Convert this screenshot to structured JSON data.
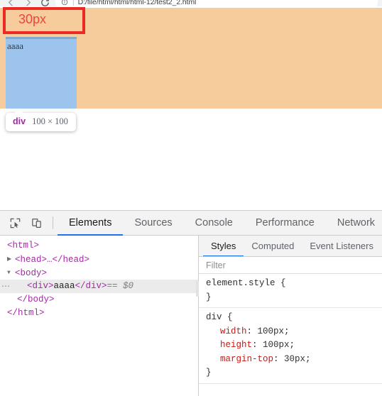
{
  "browser": {
    "back_icon": "arrow-left-icon",
    "forward_icon": "arrow-right-icon",
    "reload_icon": "reload-icon",
    "page_info_icon": "page-info-icon",
    "url": "D:/file/html/html/html-12/test2_2.html",
    "url_separator": "|"
  },
  "viewport": {
    "page_text": "aaaa",
    "annotation": {
      "label": "30px",
      "box_color": "#ec2a23",
      "text_color": "#f04438"
    },
    "highlight": {
      "margin_color": "#f7cc9c",
      "content_color": "#9dc4ec",
      "content_edge_color": "#83a8cd"
    },
    "tooltip": {
      "tag": "div",
      "dimensions": "100 × 100"
    }
  },
  "devtools": {
    "toolbar": {
      "inspect_icon": "inspect-element-icon",
      "device_toolbar_icon": "device-toolbar-icon"
    },
    "tabs": [
      {
        "label": "Elements",
        "active": true
      },
      {
        "label": "Sources",
        "active": false
      },
      {
        "label": "Console",
        "active": false
      },
      {
        "label": "Performance",
        "active": false
      },
      {
        "label": "Network",
        "active": false
      }
    ],
    "dom": {
      "rows": [
        {
          "text": "<html>",
          "indent": 1,
          "twisty": "",
          "selected": false,
          "ellipsis": false
        },
        {
          "text": "<head>…</head>",
          "indent": 2,
          "twisty": "▶",
          "selected": false,
          "ellipsis": false
        },
        {
          "text": "<body>",
          "indent": 2,
          "twisty": "▼",
          "selected": false,
          "ellipsis": false
        },
        {
          "text": "<div>aaaa</div>",
          "indent": 3,
          "twisty": "",
          "selected": true,
          "ellipsis": true,
          "suffix": "== $0"
        },
        {
          "text": "</body>",
          "indent": 2,
          "twisty": "",
          "selected": false,
          "ellipsis": false
        },
        {
          "text": "</html>",
          "indent": 1,
          "twisty": "",
          "selected": false,
          "ellipsis": false
        }
      ],
      "tag_html_open": "<html>",
      "tag_head": "<head>…</head>",
      "tag_body_open": "<body>",
      "div_open": "<div>",
      "div_text": "aaaa",
      "div_close": "</div>",
      "div_suffix": "== $0",
      "tag_body_close": "</body>",
      "tag_html_close": "</html>",
      "ellipsis_badge": "…"
    },
    "styles": {
      "tabs": [
        {
          "label": "Styles",
          "active": true
        },
        {
          "label": "Computed",
          "active": false
        },
        {
          "label": "Event Listeners",
          "active": false
        }
      ],
      "filter_placeholder": "Filter",
      "filter_value": "",
      "rules": [
        {
          "selector": "element.style {",
          "close": "}",
          "declarations": []
        },
        {
          "selector": "div {",
          "close": "}",
          "declarations": [
            {
              "property": "width",
              "value": "100px;"
            },
            {
              "property": "height",
              "value": "100px;"
            },
            {
              "property": "margin-top",
              "value": "30px;"
            }
          ]
        }
      ]
    }
  },
  "accent": {
    "tab_underline": "#1a73e8",
    "css_property": "#c41a16",
    "dom_tag": "#a428a4"
  }
}
